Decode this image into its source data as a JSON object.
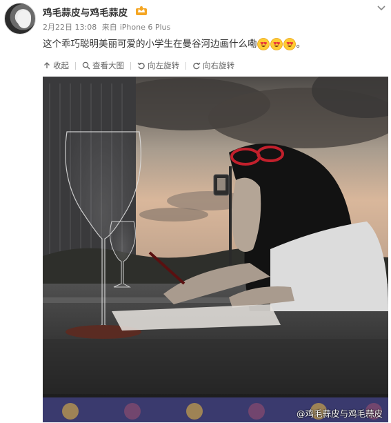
{
  "post": {
    "username": "鸡毛蒜皮与鸡毛蒜皮",
    "date": "2月22日 13:08",
    "source_prefix": "来自",
    "device": "iPhone 6 Plus",
    "text": "这个乖巧聪明美丽可爱的小学生在曼谷河边画什么嘞",
    "text_end": "。",
    "emojis": [
      "heart-eyes-emoji",
      "heart-eyes-emoji",
      "heart-eyes-emoji"
    ]
  },
  "actions": [
    {
      "icon": "collapse-arrow-icon",
      "label": "收起"
    },
    {
      "icon": "magnifier-icon",
      "label": "查看大图"
    },
    {
      "icon": "rotate-left-icon",
      "label": "向左旋转"
    },
    {
      "icon": "rotate-right-icon",
      "label": "向右旋转"
    }
  ],
  "image": {
    "watermark": "@鸡毛蒜皮与鸡毛蒜皮"
  },
  "colors": {
    "username": "#333333",
    "meta": "#808080",
    "accent_badge": "#f5a623"
  }
}
